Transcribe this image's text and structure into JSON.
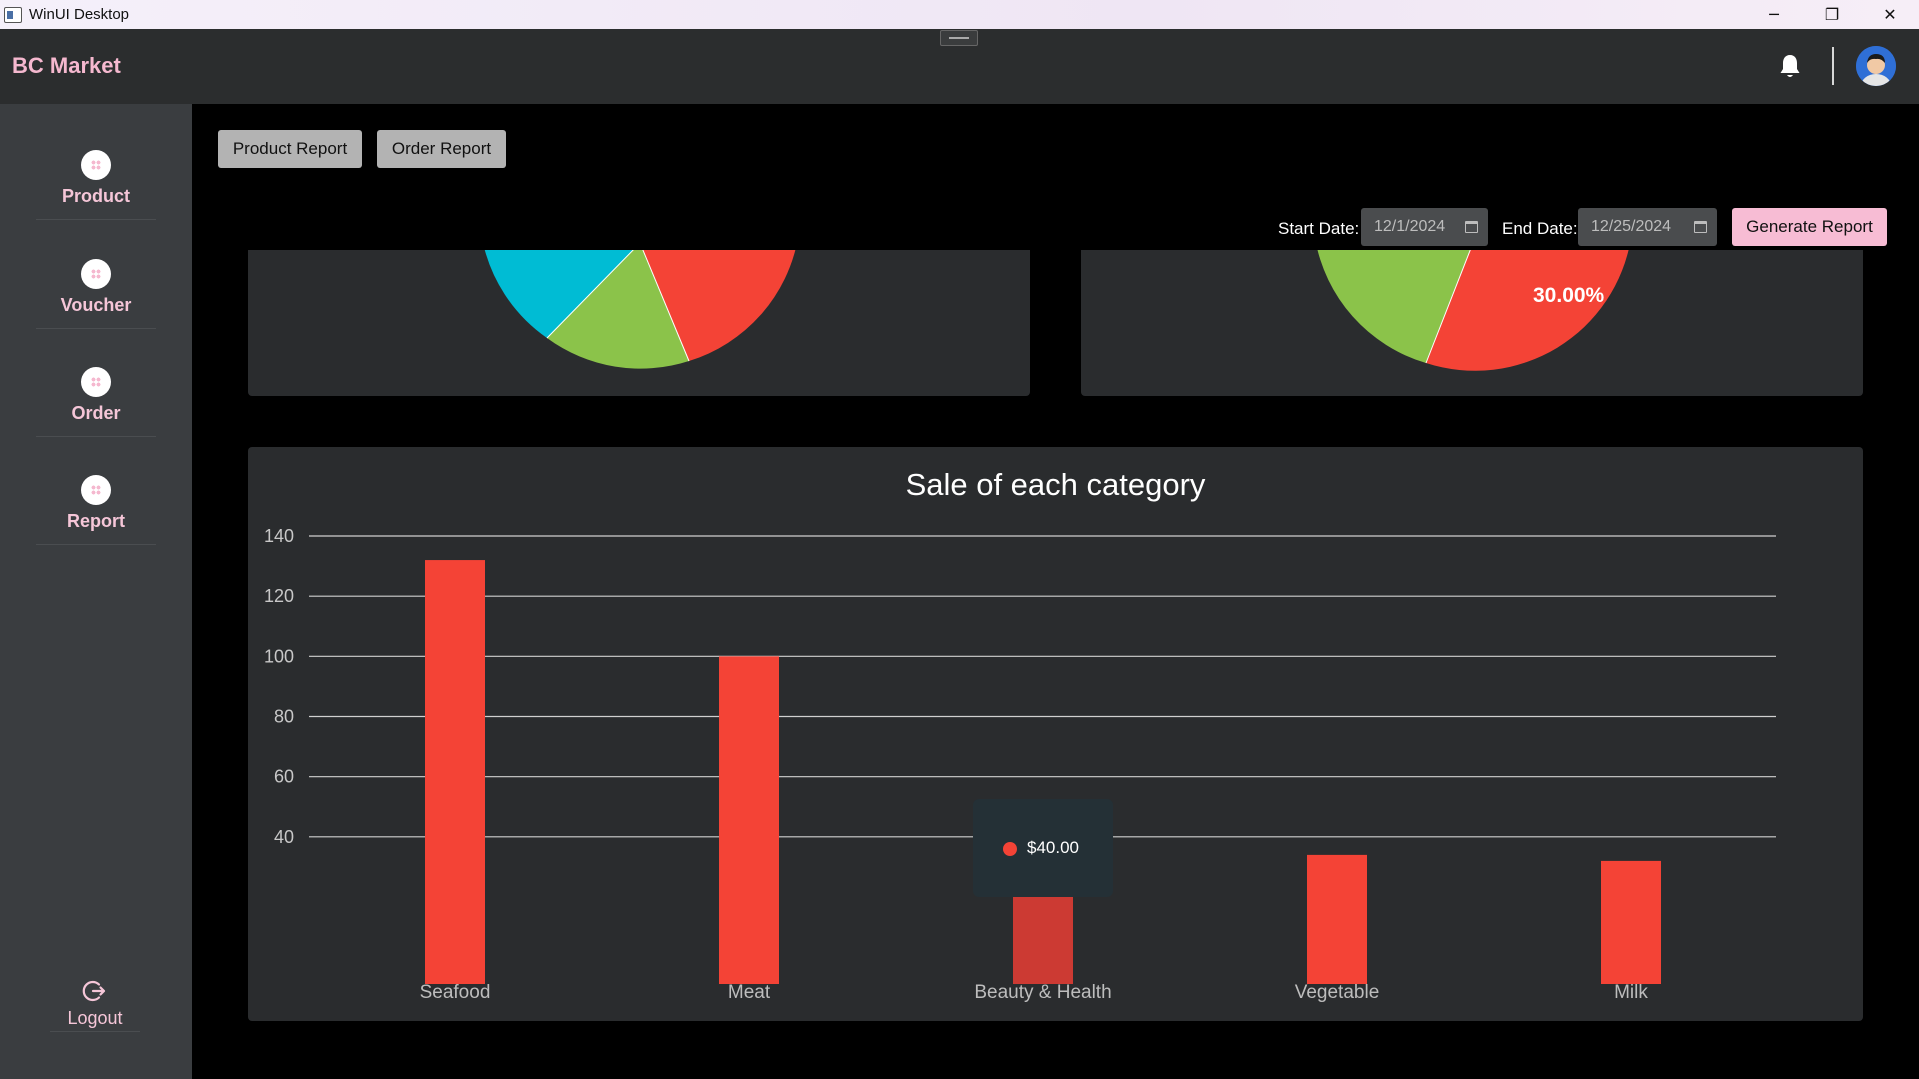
{
  "window": {
    "title": "WinUI Desktop",
    "controls": {
      "minimize": "─",
      "restore": "❐",
      "close": "✕"
    }
  },
  "header": {
    "brand": "BC Market",
    "icons": [
      "bell-icon",
      "avatar"
    ]
  },
  "sidebar": {
    "items": [
      {
        "label": "Product",
        "icon": "dots-grid-icon"
      },
      {
        "label": "Voucher",
        "icon": "dots-grid-icon"
      },
      {
        "label": "Order",
        "icon": "dots-grid-icon"
      },
      {
        "label": "Report",
        "icon": "dots-grid-icon"
      }
    ],
    "logout": {
      "label": "Logout",
      "icon": "logout-icon"
    }
  },
  "toolbar": {
    "product_report": "Product Report",
    "order_report": "Order Report",
    "start_label": "Start Date:",
    "start_value": "12/1/2024",
    "end_label": "End Date:",
    "end_value": "12/25/2024",
    "generate": "Generate Report"
  },
  "colors": {
    "accent_pink": "#f7bcd4",
    "bar_red": "#f44336",
    "pie_cyan": "#00bcd4",
    "pie_green": "#8bc34a",
    "pie_red": "#f44336"
  },
  "pies": {
    "left": {
      "visible_label": ""
    },
    "right": {
      "visible_label": "30.00%"
    }
  },
  "chart_data": {
    "type": "bar",
    "title": "Sale of each category",
    "categories": [
      "Seafood",
      "Meat",
      "Beauty & Health",
      "Vegetable",
      "Milk"
    ],
    "values": [
      132,
      100,
      40,
      34,
      32
    ],
    "ylim": [
      30,
      140
    ],
    "yticks": [
      40,
      60,
      80,
      100,
      120,
      140
    ],
    "grid": true,
    "tooltip": {
      "category_index": 2,
      "text": "$40.00"
    }
  }
}
